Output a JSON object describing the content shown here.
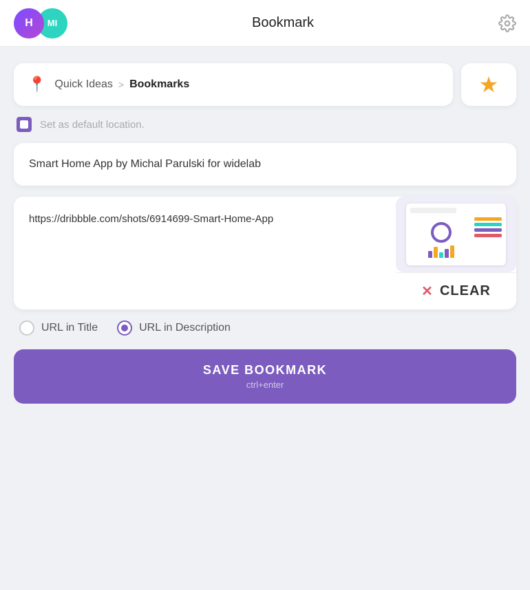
{
  "header": {
    "title": "Bookmark",
    "avatar_h": "H",
    "avatar_mi": "MI"
  },
  "breadcrumb": {
    "location_icon": "📍",
    "parent": "Quick Ideas",
    "arrow": ">",
    "current": "Bookmarks"
  },
  "default_location": {
    "label": "Set as default location."
  },
  "title_card": {
    "text": "Smart Home App by Michal Parulski for widelab"
  },
  "url_card": {
    "url": "https://dribbble.com/shots/6914699-Smart-Home-App",
    "clear_label": "CLEAR"
  },
  "radio_options": {
    "option1_label": "URL in Title",
    "option2_label": "URL in Description",
    "selected": "option2"
  },
  "save_button": {
    "label": "SAVE BOOKMARK",
    "hint": "ctrl+enter"
  },
  "mini_bars": [
    {
      "height": 10,
      "color": "#7c5cbf"
    },
    {
      "height": 16,
      "color": "#f5a623"
    },
    {
      "height": 8,
      "color": "#2dd4c0"
    },
    {
      "height": 13,
      "color": "#7c5cbf"
    },
    {
      "height": 18,
      "color": "#f5a623"
    }
  ],
  "mini_legend": [
    {
      "color": "#f5a623"
    },
    {
      "color": "#2dd4c0"
    },
    {
      "color": "#7c5cbf"
    },
    {
      "color": "#e05a6a"
    }
  ]
}
